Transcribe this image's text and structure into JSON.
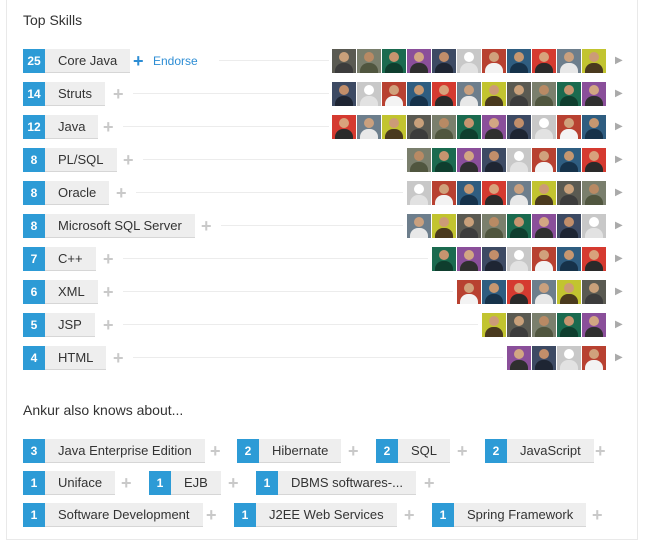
{
  "top_skills_title": "Top Skills",
  "endorse_label": "Endorse",
  "also_knows_title": "Ankur also knows about...",
  "skills": [
    {
      "count": "25",
      "name": "Core Java"
    },
    {
      "count": "14",
      "name": "Struts"
    },
    {
      "count": "12",
      "name": "Java"
    },
    {
      "count": "8",
      "name": "PL/SQL"
    },
    {
      "count": "8",
      "name": "Oracle"
    },
    {
      "count": "8",
      "name": "Microsoft SQL Server"
    },
    {
      "count": "7",
      "name": "C++"
    },
    {
      "count": "6",
      "name": "XML"
    },
    {
      "count": "5",
      "name": "JSP"
    },
    {
      "count": "4",
      "name": "HTML"
    }
  ],
  "other_skills": [
    {
      "count": "3",
      "name": "Java Enterprise Edition"
    },
    {
      "count": "2",
      "name": "Hibernate"
    },
    {
      "count": "2",
      "name": "SQL"
    },
    {
      "count": "2",
      "name": "JavaScript"
    },
    {
      "count": "1",
      "name": "Uniface"
    },
    {
      "count": "1",
      "name": "EJB"
    },
    {
      "count": "1",
      "name": "DBMS softwares-..."
    },
    {
      "count": "1",
      "name": "Software Development"
    },
    {
      "count": "1",
      "name": "J2EE Web Services"
    },
    {
      "count": "1",
      "name": "Spring Framework"
    }
  ],
  "colors": {
    "count_badge": "#2d9bd6",
    "chip_bg": "#eeeeee",
    "link": "#2d8dd4",
    "plus_gray": "#c9c9c9"
  },
  "icons": {
    "plus": "plus-icon",
    "arrow": "chevron-right-icon",
    "avatar": "user-avatar"
  }
}
